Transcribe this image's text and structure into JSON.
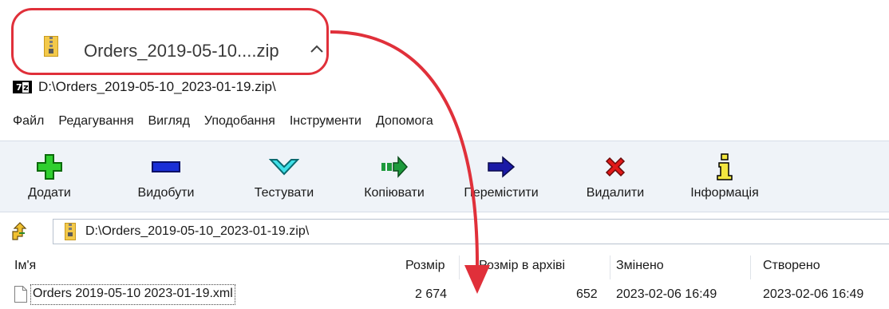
{
  "download": {
    "file_name": "Orders_2019-05-10....zip",
    "highlight_color": "#e0303a",
    "chevron": "chevron-up-icon"
  },
  "window": {
    "app_icon": "7z-icon",
    "title": "D:\\Orders_2019-05-10_2023-01-19.zip\\"
  },
  "menu": [
    "Файл",
    "Редагування",
    "Вигляд",
    "Уподобання",
    "Інструменти",
    "Допомога"
  ],
  "toolbar": {
    "add": "Додати",
    "extract": "Видобути",
    "test": "Тестувати",
    "copy": "Копіювати",
    "move": "Перемістити",
    "delete": "Видалити",
    "info": "Інформація"
  },
  "address": {
    "path": "D:\\Orders_2019-05-10_2023-01-19.zip\\"
  },
  "columns": {
    "name": "Ім'я",
    "size": "Розмір",
    "packed": "Розмір в архіві",
    "modified": "Змінено",
    "created": "Створено"
  },
  "files": [
    {
      "name": "Orders 2019-05-10 2023-01-19.xml",
      "size": "2 674",
      "packed": "652",
      "modified": "2023-02-06 16:49",
      "created": "2023-02-06 16:49"
    }
  ],
  "colors": {
    "annotation": "#e0303a",
    "toolbar_bg": "#eff3f8"
  }
}
